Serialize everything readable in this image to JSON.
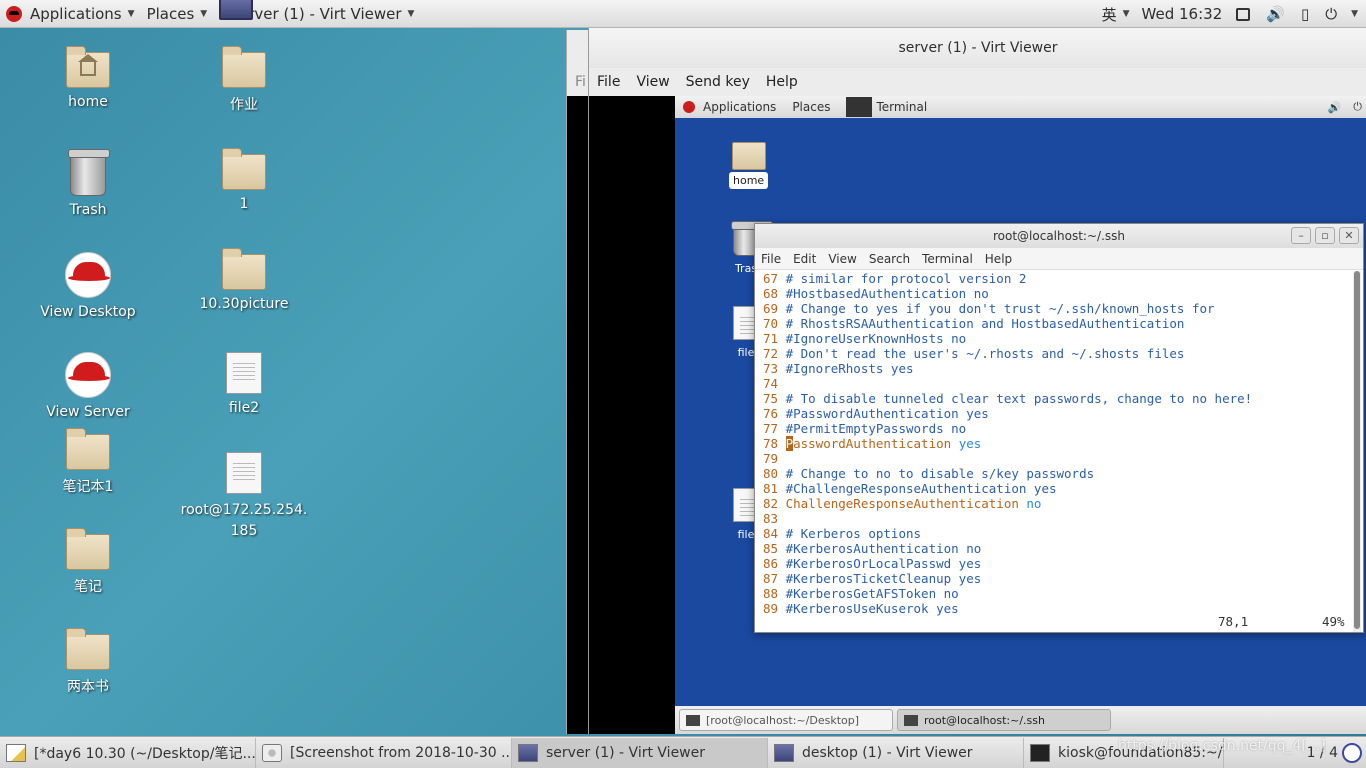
{
  "top_panel": {
    "applications": "Applications",
    "places": "Places",
    "window_title": "server (1) - Virt Viewer",
    "input_method": "英",
    "clock": "Wed 16:32"
  },
  "desktop_icons": [
    {
      "label": "home"
    },
    {
      "label": "作业"
    },
    {
      "label": "Trash"
    },
    {
      "label": "1"
    },
    {
      "label": "View Desktop"
    },
    {
      "label": "10.30picture"
    },
    {
      "label": "View Server"
    },
    {
      "label": "file2"
    },
    {
      "label": "笔记本1"
    },
    {
      "label": "root@172.25.254.185"
    },
    {
      "label": "笔记"
    },
    {
      "label": "两本书"
    }
  ],
  "virt_viewer": {
    "title": "server (1) - Virt Viewer",
    "left_fragment": "Fi",
    "menu": [
      "File",
      "View",
      "Send key",
      "Help"
    ]
  },
  "guest": {
    "top": {
      "applications": "Applications",
      "places": "Places",
      "terminal": "Terminal"
    },
    "desktop": {
      "home": "home",
      "trash_fragment": "Tras",
      "file_fragment_1": "file",
      "file_fragment_2": "file"
    },
    "terminal": {
      "title": "root@localhost:~/.ssh",
      "menu": [
        "File",
        "Edit",
        "View",
        "Search",
        "Terminal",
        "Help"
      ],
      "status_pos": "78,1",
      "status_pct": "49%"
    },
    "taskbar": [
      "[root@localhost:~/Desktop]",
      "root@localhost:~/.ssh"
    ]
  },
  "taskbar": {
    "items": [
      "[*day6 10.30 (~/Desktop/笔记...",
      "[Screenshot from 2018-10-30 ...",
      "server (1) - Virt Viewer",
      "desktop (1) - Virt Viewer",
      "kiosk@foundation85:~/.ssh"
    ],
    "pager": "1 / 4",
    "watermark": "https://blog.csdn.net/qq_4[...]"
  },
  "file_lines": [
    {
      "n": "67",
      "t": "# similar for protocol version 2"
    },
    {
      "n": "68",
      "t": "#HostbasedAuthentication no"
    },
    {
      "n": "69",
      "t": "# Change to yes if you don't trust ~/.ssh/known_hosts for"
    },
    {
      "n": "70",
      "t": "# RhostsRSAAuthentication and HostbasedAuthentication"
    },
    {
      "n": "71",
      "t": "#IgnoreUserKnownHosts no"
    },
    {
      "n": "72",
      "t": "# Don't read the user's ~/.rhosts and ~/.shosts files"
    },
    {
      "n": "73",
      "t": "#IgnoreRhosts yes"
    },
    {
      "n": "74",
      "t": ""
    },
    {
      "n": "75",
      "t": "# To disable tunneled clear text passwords, change to no here!"
    },
    {
      "n": "76",
      "t": "#PasswordAuthentication yes"
    },
    {
      "n": "77",
      "t": "#PermitEmptyPasswords no"
    },
    {
      "n": "78",
      "k": "PasswordAuthentication",
      "v": "yes"
    },
    {
      "n": "79",
      "t": ""
    },
    {
      "n": "80",
      "t": "# Change to no to disable s/key passwords"
    },
    {
      "n": "81",
      "t": "#ChallengeResponseAuthentication yes"
    },
    {
      "n": "82",
      "k": "ChallengeResponseAuthentication",
      "v": "no"
    },
    {
      "n": "83",
      "t": ""
    },
    {
      "n": "84",
      "t": "# Kerberos options"
    },
    {
      "n": "85",
      "t": "#KerberosAuthentication no"
    },
    {
      "n": "86",
      "t": "#KerberosOrLocalPasswd yes"
    },
    {
      "n": "87",
      "t": "#KerberosTicketCleanup yes"
    },
    {
      "n": "88",
      "t": "#KerberosGetAFSToken no"
    },
    {
      "n": "89",
      "t": "#KerberosUseKuserok yes"
    }
  ]
}
